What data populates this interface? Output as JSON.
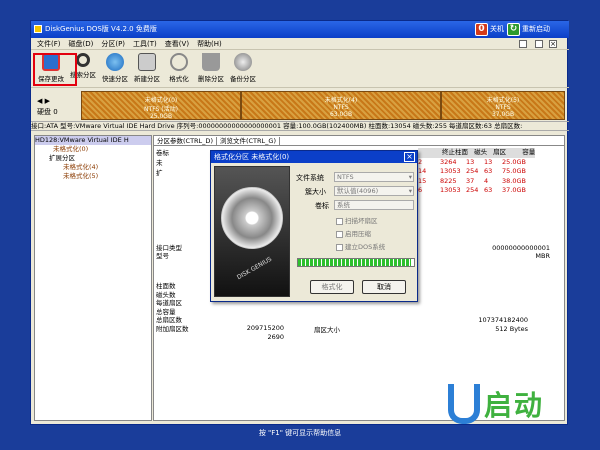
{
  "window": {
    "title": "DiskGenius DOS版 V4.2.0 免费版",
    "restart_label": "重新启动",
    "shutdown_label": "关机"
  },
  "menu": [
    "文件(F)",
    "磁盘(D)",
    "分区(P)",
    "工具(T)",
    "查看(V)",
    "帮助(H)"
  ],
  "toolbar": [
    "保存更改",
    "搜索分区",
    "快速分区",
    "新建分区",
    "格式化",
    "删除分区",
    "备份分区"
  ],
  "diskmap": {
    "disk_label": "硬盘 0",
    "parts": [
      {
        "name": "未格式化(0)",
        "fs": "NTFS (活动)",
        "size": "25.0GB"
      },
      {
        "name": "未格式化(4)",
        "fs": "NTFS",
        "size": "63.0GB"
      },
      {
        "name": "未格式化(5)",
        "fs": "NTFS",
        "size": "37.0GB"
      }
    ]
  },
  "infobar": "接口:ATA  型号:VMware Virtual IDE Hard Drive  序列号:00000000000000000001  容量:100.0GB(102400MB)  柱面数:13054  磁头数:255  每道扇区数:63  总扇区数:",
  "tree": [
    "HD128:VMware Virtual IDE H",
    "未格式化(0)",
    "扩展分区",
    "未格式化(4)",
    "未格式化(5)"
  ],
  "tabs": [
    "分区参数(CTRL_D)",
    "浏览文件(CTRL_G)"
  ],
  "table": {
    "headers": [
      "终止柱面",
      "磁头",
      "扇区",
      "容量"
    ],
    "rows": [
      [
        "2",
        "3264",
        "13",
        "13",
        "25.0GB"
      ],
      [
        "14",
        "13053",
        "254",
        "63",
        "75.0GB"
      ],
      [
        "15",
        "8225",
        "37",
        "4",
        "38.0GB"
      ],
      [
        "6",
        "13053",
        "254",
        "63",
        "37.0GB"
      ]
    ]
  },
  "left_labels": [
    "卷标",
    "未",
    "扩"
  ],
  "details": {
    "iface_label": "接口类型",
    "model_label": "型号",
    "serial_value": "00000000000001",
    "model_value": "MBR",
    "labels": [
      "柱面数",
      "磁头数",
      "每道扇区",
      "总容量",
      "总扇区数",
      "附加扇区数"
    ],
    "total_sectors": "209715200",
    "extra_sectors": "2690",
    "sector_size_label": "扇区大小",
    "bytes_value": "107374182400",
    "sector_size": "512 Bytes"
  },
  "dialog": {
    "title": "格式化分区 未格式化(0)",
    "fs_label": "文件系统",
    "fs_value": "NTFS",
    "cluster_label": "簇大小",
    "cluster_value": "默认值(4096)",
    "vol_label": "卷标",
    "vol_value": "系统",
    "checks": [
      "扫描坏扇区",
      "启用压缩",
      "建立DOS系统"
    ],
    "progress": 0.97,
    "btn_format": "格式化",
    "btn_cancel": "取消",
    "hdd_text": "DISK GENIUS"
  },
  "status": "按 \"F1\" 键可显示帮助信息",
  "logo_text": "启动"
}
